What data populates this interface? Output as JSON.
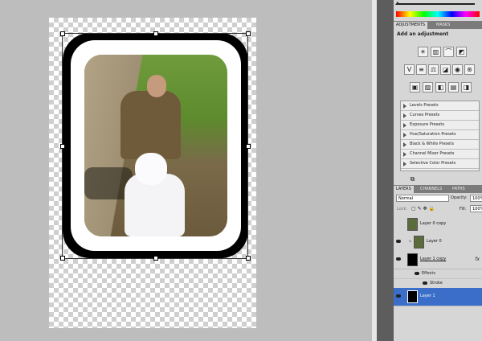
{
  "panels": {
    "adjustments": {
      "tabs": [
        "ADJUSTMENTS",
        "MASKS"
      ],
      "title": "Add an adjustment",
      "icon_rows": [
        [
          "brightness-icon",
          "levels-icon",
          "curves-icon",
          "exposure-icon"
        ],
        [
          "vibrance-icon",
          "hue-sat-icon",
          "color-balance-icon",
          "bw-icon",
          "photo-filter-icon",
          "channel-mixer-icon"
        ],
        [
          "invert-icon",
          "posterize-icon",
          "threshold-icon",
          "gradient-map-icon",
          "selective-color-icon"
        ]
      ],
      "presets": [
        "Levels Presets",
        "Curves Presets",
        "Exposure Presets",
        "Hue/Saturation Presets",
        "Black & White Presets",
        "Channel Mixer Presets",
        "Selective Color Presets"
      ]
    },
    "layers": {
      "tabs": [
        "LAYERS",
        "CHANNELS",
        "PATHS"
      ],
      "blend_mode": "Normal",
      "opacity_label": "Opacity:",
      "opacity_value": "100%",
      "lock_label": "Lock:",
      "fill_label": "Fill:",
      "fill_value": "100%",
      "rows": [
        {
          "name": "Layer 0 copy",
          "visible": false,
          "selected": false
        },
        {
          "name": "Layer 0",
          "visible": true,
          "selected": false
        },
        {
          "name": "Layer 1 copy",
          "visible": true,
          "selected": false,
          "fx": "fx"
        },
        {
          "name": "Layer 1",
          "visible": true,
          "selected": true
        }
      ],
      "effects_label": "Effects",
      "stroke_label": "Stroke"
    }
  },
  "colors": {
    "selection": "#3a6ec9",
    "panel_bg": "#d6d6d6",
    "canvas_bg": "#bdbdbd"
  }
}
